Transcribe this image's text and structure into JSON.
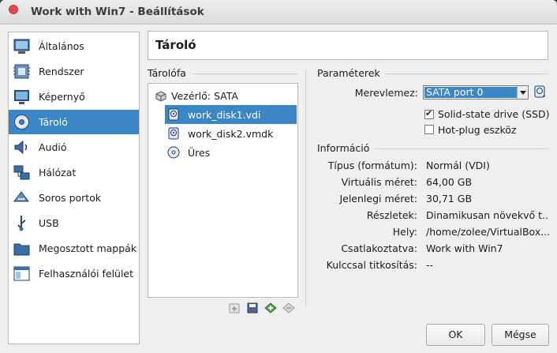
{
  "window": {
    "title": "Work with Win7 - Beállítások"
  },
  "sidebar": {
    "items": [
      {
        "label": "Általános",
        "icon": "general-icon"
      },
      {
        "label": "Rendszer",
        "icon": "system-icon"
      },
      {
        "label": "Képernyő",
        "icon": "display-icon"
      },
      {
        "label": "Tároló",
        "icon": "storage-icon",
        "selected": true
      },
      {
        "label": "Audió",
        "icon": "audio-icon"
      },
      {
        "label": "Hálózat",
        "icon": "network-icon"
      },
      {
        "label": "Soros portok",
        "icon": "serial-ports-icon"
      },
      {
        "label": "USB",
        "icon": "usb-icon"
      },
      {
        "label": "Megosztott mappák",
        "icon": "shared-folders-icon"
      },
      {
        "label": "Felhasználói felület",
        "icon": "user-interface-icon"
      }
    ]
  },
  "page": {
    "title": "Tároló"
  },
  "storage_tree": {
    "label": "Tárolófa",
    "controller": "Vezérlő: SATA",
    "items": [
      {
        "label": "work_disk1.vdi",
        "icon": "hard-disk-icon",
        "selected": true
      },
      {
        "label": "work_disk2.vmdk",
        "icon": "hard-disk-icon"
      },
      {
        "label": "Üres",
        "icon": "optical-disc-icon"
      }
    ],
    "toolbar": [
      "add-controller-icon",
      "remove-controller-icon",
      "add-attachment-icon",
      "remove-attachment-icon"
    ]
  },
  "parameters": {
    "label": "Paraméterek",
    "drive_label": "Merevlemez:",
    "drive_value": "SATA port 0",
    "ssd_label": "Solid-state drive (SSD)",
    "ssd_checked": true,
    "hotplug_label": "Hot-plug eszköz",
    "hotplug_checked": false
  },
  "info": {
    "label": "Információ",
    "rows": [
      {
        "label": "Típus (formátum):",
        "value": "Normál (VDI)"
      },
      {
        "label": "Virtuális méret:",
        "value": "64,00 GB"
      },
      {
        "label": "Jelenlegi méret:",
        "value": "30,71 GB"
      },
      {
        "label": "Részletek:",
        "value": "Dinamikusan növekvő t..."
      },
      {
        "label": "Hely:",
        "value": "/home/zolee/VirtualBox..."
      },
      {
        "label": "Csatlakoztatva:",
        "value": "Work with Win7"
      },
      {
        "label": "Kulccsal titkosítás:",
        "value": "--"
      }
    ]
  },
  "buttons": {
    "ok": "OK",
    "cancel": "Mégse"
  },
  "colors": {
    "selection": "#3b86c6",
    "close": "#e8444c"
  }
}
